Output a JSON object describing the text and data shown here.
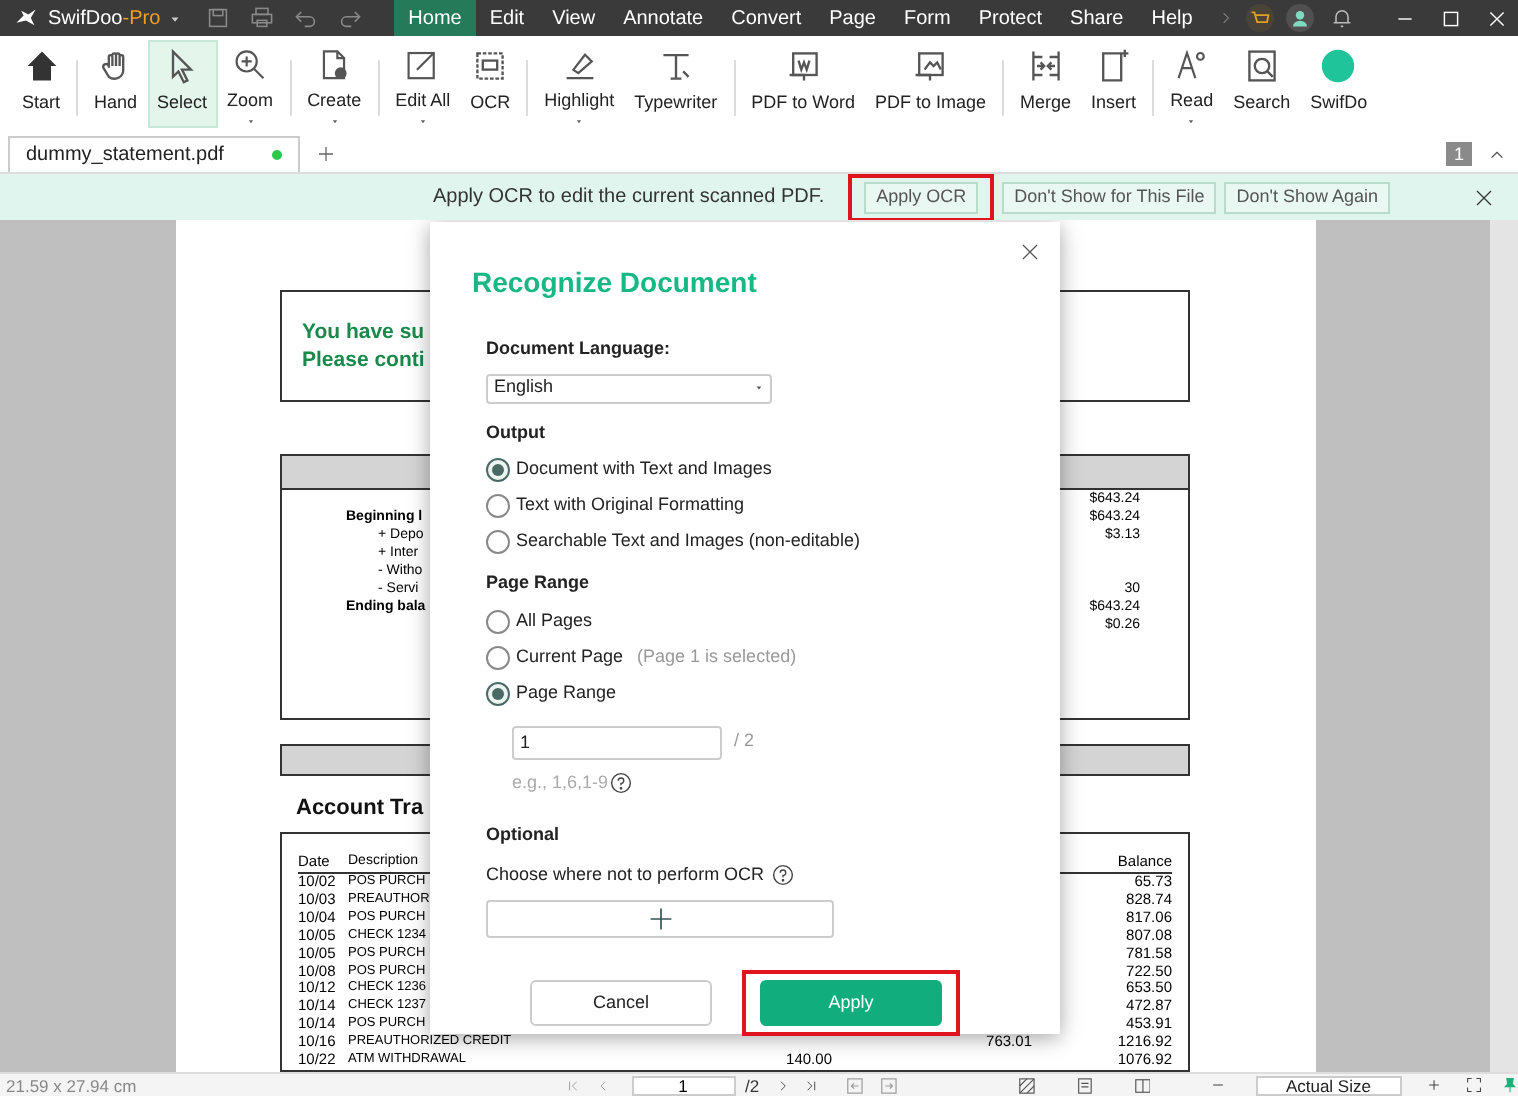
{
  "app": {
    "name": "SwifDoo",
    "edition": "-Pro"
  },
  "menu_tabs": [
    {
      "label": "Home",
      "selected": true
    },
    {
      "label": "Edit",
      "selected": false
    },
    {
      "label": "View",
      "selected": false
    },
    {
      "label": "Annotate",
      "selected": false
    },
    {
      "label": "Convert",
      "selected": false
    },
    {
      "label": "Page",
      "selected": false
    },
    {
      "label": "Form",
      "selected": false
    },
    {
      "label": "Protect",
      "selected": false
    },
    {
      "label": "Share",
      "selected": false
    },
    {
      "label": "Help",
      "selected": false
    }
  ],
  "ribbon_groups": [
    [
      {
        "label": "Start",
        "dropdown": false,
        "selected": false
      }
    ],
    [
      {
        "label": "Hand",
        "dropdown": false,
        "selected": false
      },
      {
        "label": "Select",
        "dropdown": false,
        "selected": true
      },
      {
        "label": "Zoom",
        "dropdown": true,
        "selected": false
      }
    ],
    [
      {
        "label": "Create",
        "dropdown": true,
        "selected": false
      }
    ],
    [
      {
        "label": "Edit All",
        "dropdown": true,
        "selected": false
      },
      {
        "label": "OCR",
        "dropdown": false,
        "selected": false
      }
    ],
    [
      {
        "label": "Highlight",
        "dropdown": true,
        "selected": false
      },
      {
        "label": "Typewriter",
        "dropdown": false,
        "selected": false
      }
    ],
    [
      {
        "label": "PDF to Word",
        "dropdown": false,
        "selected": false
      },
      {
        "label": "PDF to Image",
        "dropdown": false,
        "selected": false
      }
    ],
    [
      {
        "label": "Merge",
        "dropdown": false,
        "selected": false
      },
      {
        "label": "Insert",
        "dropdown": false,
        "selected": false
      }
    ],
    [
      {
        "label": "Read",
        "dropdown": true,
        "selected": false
      },
      {
        "label": "Search",
        "dropdown": false,
        "selected": false
      },
      {
        "label": "SwifDo",
        "dropdown": false,
        "selected": false
      }
    ]
  ],
  "document_tabs": [
    {
      "label": "dummy_statement.pdf",
      "selected": true,
      "modified": true
    }
  ],
  "page_count_badge": "1",
  "ocr_banner": {
    "message": "Apply OCR to edit the current scanned PDF.",
    "buttons": [
      {
        "label": "Apply OCR",
        "highlighted": true
      },
      {
        "label": "Don't Show for This File",
        "highlighted": false
      },
      {
        "label": "Don't Show Again",
        "highlighted": false
      }
    ]
  },
  "document": {
    "notice_lines": [
      "You have su",
      "Please conti"
    ],
    "summary": [
      {
        "value": "$643.24"
      },
      {
        "label": "Beginning l",
        "kind": "total",
        "value": "$643.24"
      },
      {
        "label": "+ Depo",
        "kind": "item",
        "value": "$3.13"
      },
      {
        "label": "+ Inter",
        "kind": "item"
      },
      {
        "label": "- Witho",
        "kind": "item"
      },
      {
        "label": "- Servi",
        "kind": "item",
        "value": "30"
      },
      {
        "label": "Ending bala",
        "kind": "total",
        "value": "$643.24"
      },
      {
        "value": "$0.26"
      }
    ],
    "section_title": "Account Tra",
    "columns": [
      "Date",
      "Description",
      "Balance"
    ],
    "rows": [
      {
        "date": "10/02",
        "description": "POS PURCH",
        "balance": "65.73"
      },
      {
        "date": "10/03",
        "description": "PREAUTHOR",
        "balance": "828.74"
      },
      {
        "date": "10/04",
        "description": "POS PURCH",
        "balance": "817.06"
      },
      {
        "date": "10/05",
        "description": "CHECK 1234",
        "balance": "807.08"
      },
      {
        "date": "10/05",
        "description": "POS PURCH",
        "balance": "781.58"
      },
      {
        "date": "10/08",
        "description": "POS PURCH",
        "balance": "722.50"
      },
      {
        "date": "10/12",
        "description": "CHECK 1236",
        "balance": "653.50"
      },
      {
        "date": "10/14",
        "description": "CHECK 1237",
        "balance": "472.87"
      },
      {
        "date": "10/14",
        "description": "POS PURCH",
        "balance": "453.91"
      },
      {
        "date": "10/16",
        "description": "PREAUTHORIZED CREDIT",
        "credit": "763.01",
        "balance": "1216.92"
      },
      {
        "date": "10/22",
        "description": "ATM WITHDRAWAL",
        "debit": "140.00",
        "balance": "1076.92"
      }
    ]
  },
  "dialog": {
    "title": "Recognize Document",
    "language_label": "Document Language:",
    "language": "English",
    "output_heading": "Output",
    "output_options": [
      {
        "label": "Document with Text and Images",
        "selected": true
      },
      {
        "label": "Text with Original Formatting",
        "selected": false
      },
      {
        "label": "Searchable Text and Images (non-editable)",
        "selected": false
      }
    ],
    "range_heading": "Page Range",
    "range_options": [
      {
        "label": "All Pages",
        "selected": false
      },
      {
        "label": "Current Page",
        "note": "(Page 1 is selected)",
        "selected": false
      },
      {
        "label": "Page Range",
        "selected": true
      }
    ],
    "range_value": "1",
    "range_total": "/ 2",
    "range_hint": "e.g., 1,6,1-9",
    "optional_heading": "Optional",
    "exclude_label": "Choose where not to perform OCR",
    "buttons": [
      {
        "label": "Cancel",
        "kind": "secondary",
        "highlighted": false
      },
      {
        "label": "Apply",
        "kind": "primary",
        "highlighted": true
      }
    ]
  },
  "status_bar": {
    "page_size": "21.59 x 27.94 cm",
    "page": "1",
    "total": "/2",
    "zoom": "Actual Size"
  }
}
